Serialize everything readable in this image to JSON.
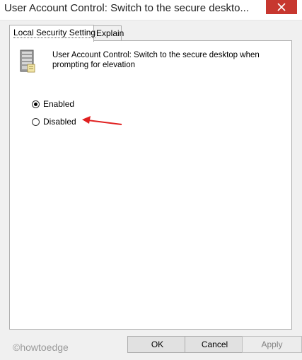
{
  "window": {
    "title": "User Account Control: Switch to the secure deskto..."
  },
  "tabs": [
    {
      "label": "Local Security Setting",
      "active": true
    },
    {
      "label": "Explain",
      "active": false
    }
  ],
  "policy": {
    "icon": "server-icon",
    "description": "User Account Control: Switch to the secure desktop when prompting for elevation"
  },
  "options": [
    {
      "label": "Enabled",
      "selected": true
    },
    {
      "label": "Disabled",
      "selected": false
    }
  ],
  "annotation": {
    "icon": "red-arrow-icon",
    "color": "#e02020"
  },
  "buttons": {
    "ok": "OK",
    "cancel": "Cancel",
    "apply": "Apply"
  },
  "watermark": "©howtoedge"
}
